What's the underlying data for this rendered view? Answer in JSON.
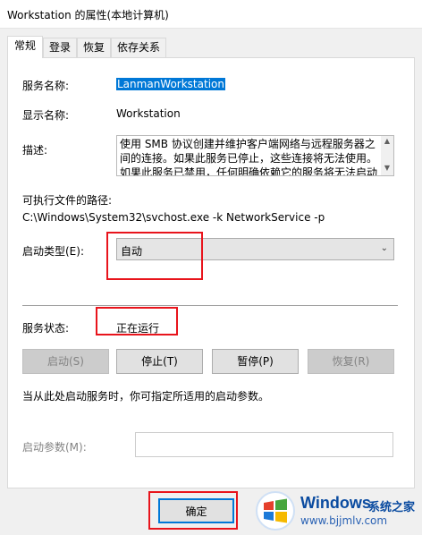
{
  "window": {
    "title": "Workstation 的属性(本地计算机)"
  },
  "tabs": [
    {
      "label": "常规",
      "active": true
    },
    {
      "label": "登录",
      "active": false
    },
    {
      "label": "恢复",
      "active": false
    },
    {
      "label": "依存关系",
      "active": false
    }
  ],
  "general": {
    "service_name_label": "服务名称:",
    "service_name_value": "LanmanWorkstation",
    "display_name_label": "显示名称:",
    "display_name_value": "Workstation",
    "description_label": "描述:",
    "description_lines": [
      "使用 SMB 协议创建并维护客户端网络与远程服务器之",
      "间的连接。如果此服务已停止，这些连接将无法使用。",
      "如果此服务已禁用，任何明确依赖它的服务将无法启动"
    ],
    "exe_path_label": "可执行文件的路径:",
    "exe_path_value": "C:\\Windows\\System32\\svchost.exe -k NetworkService -p",
    "startup_type_label": "启动类型(E):",
    "startup_type_value": "自动",
    "service_status_label": "服务状态:",
    "service_status_value": "正在运行",
    "buttons": {
      "start": "启动(S)",
      "stop": "停止(T)",
      "pause": "暂停(P)",
      "resume": "恢复(R)"
    },
    "hint": "当从此处启动服务时，你可指定所适用的启动参数。",
    "start_params_label": "启动参数(M):",
    "start_params_value": ""
  },
  "footer": {
    "ok_label": "确定"
  },
  "watermark": {
    "brand": "Windows",
    "brand_cn": "系统之家",
    "url": "www.bjjmlv.com"
  },
  "colors": {
    "highlight": "#e8141c",
    "selection": "#0078d7"
  }
}
